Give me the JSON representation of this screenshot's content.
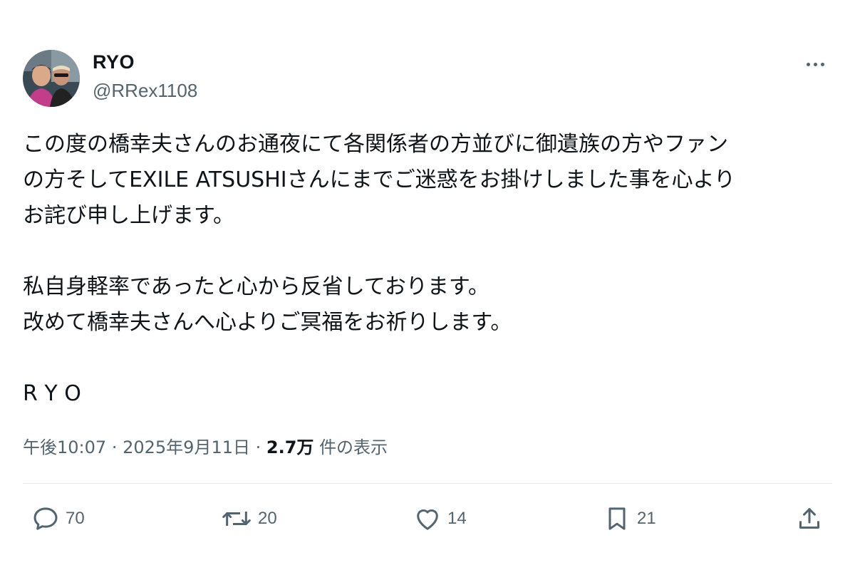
{
  "header": {
    "display_name": "RYO",
    "handle": "@RRex1108"
  },
  "post": {
    "lines": [
      "この度の橋幸夫さんのお通夜にて各関係者の方並びに御遺族の方やファン",
      "の方そしてEXILE ATSUSHIさんにまでご迷惑をお掛けしました事を心より",
      "お詫び申し上げます。",
      "",
      "私自身軽率であったと心から反省しております。",
      "改めて橋幸夫さんへ心よりご冥福をお祈りします。",
      "",
      "R Y O"
    ]
  },
  "meta": {
    "time": "午後10:07",
    "date": "2025年9月11日",
    "views_count": "2.7万",
    "views_label": "件の表示",
    "separator": "·"
  },
  "actions": {
    "replies": "70",
    "reposts": "20",
    "likes": "14",
    "bookmarks": "21"
  },
  "icons": {
    "more": "more-dots-icon",
    "reply": "reply-bubble-icon",
    "repost": "repost-arrows-icon",
    "like": "heart-icon",
    "bookmark": "bookmark-icon",
    "share": "share-upload-icon"
  },
  "colors": {
    "text": "#0f1419",
    "secondary": "#536471",
    "divider": "#e6e9eb",
    "background": "#ffffff"
  }
}
